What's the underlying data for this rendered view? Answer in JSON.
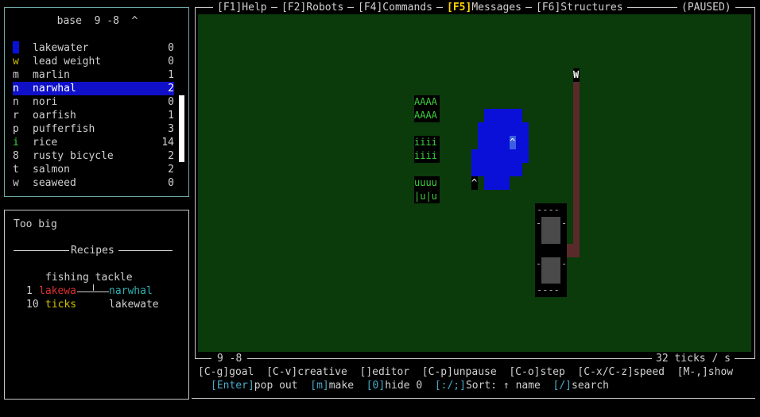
{
  "menu": {
    "help": "[F1]Help",
    "robots": "[F2]Robots",
    "commands": "[F4]Commands",
    "messages_key": "[F5]",
    "messages_label": "Messages",
    "structures": "[F6]Structures",
    "status": "(PAUSED)"
  },
  "inventory": {
    "title": "base  9 -8  ^",
    "items": [
      {
        "glyph": "█",
        "name": "lakewater",
        "count": "0",
        "glyph_color": "#0a10d8"
      },
      {
        "glyph": "w",
        "name": "lead weight",
        "count": "0",
        "glyph_color": "#d0c000"
      },
      {
        "glyph": "m",
        "name": "marlin",
        "count": "1",
        "glyph_color": "#d0d0d0"
      },
      {
        "glyph": "n",
        "name": "narwhal",
        "count": "2",
        "glyph_color": "#ffffff"
      },
      {
        "glyph": "n",
        "name": "nori",
        "count": "0",
        "glyph_color": "#d0d0d0"
      },
      {
        "glyph": "r",
        "name": "oarfish",
        "count": "1",
        "glyph_color": "#d0d0d0"
      },
      {
        "glyph": "p",
        "name": "pufferfish",
        "count": "3",
        "glyph_color": "#d0d0d0"
      },
      {
        "glyph": "i",
        "name": "rice",
        "count": "14",
        "glyph_color": "#3cd23c"
      },
      {
        "glyph": "8",
        "name": "rusty bicycle",
        "count": "2",
        "glyph_color": "#d0d0d0"
      },
      {
        "glyph": "t",
        "name": "salmon",
        "count": "2",
        "glyph_color": "#d0d0d0"
      },
      {
        "glyph": "w",
        "name": "seaweed",
        "count": "0",
        "glyph_color": "#d0d0d0"
      }
    ],
    "selected_index": 3
  },
  "info": {
    "message": "Too big",
    "recipes_header": "Recipes",
    "recipe_output": "fishing tackle",
    "row1_qty": "1",
    "row1_input": "lakewa",
    "row1_output": "narwhal",
    "row2_qty": "10",
    "row2_input": "ticks",
    "row2_output": "lakewate",
    "colors": {
      "input_red": "#e03030",
      "ticks_yellow": "#d0c000",
      "output_teal": "#30b0b0"
    }
  },
  "world": {
    "bot_label": "W",
    "base_label": "^",
    "rice_row1": "AAAA",
    "rice_row2": "AAAA",
    "rice_row3": "iiii",
    "rice_row4": "iiii",
    "u_row1": "uuuu",
    "u_row2": "|u|u",
    "water_marker": "^",
    "struct_dash": "----",
    "struct_side": "-"
  },
  "status_bar": {
    "coords": "9 -8",
    "speed": "32 ticks / s"
  },
  "keys": {
    "line1": "[C-g]goal  [C-v]creative  []editor  [C-p]unpause  [C-o]step  [C-x/C-z]speed  [M-,]show",
    "enter": "[Enter]",
    "enter_label": "pop out",
    "m": "[m]",
    "m_label": "make",
    "zero": "[0]",
    "zero_label": "hide 0",
    "sort": "[:/;]",
    "sort_label": "Sort: ↑ name",
    "search": "[/]",
    "search_label": "search"
  }
}
